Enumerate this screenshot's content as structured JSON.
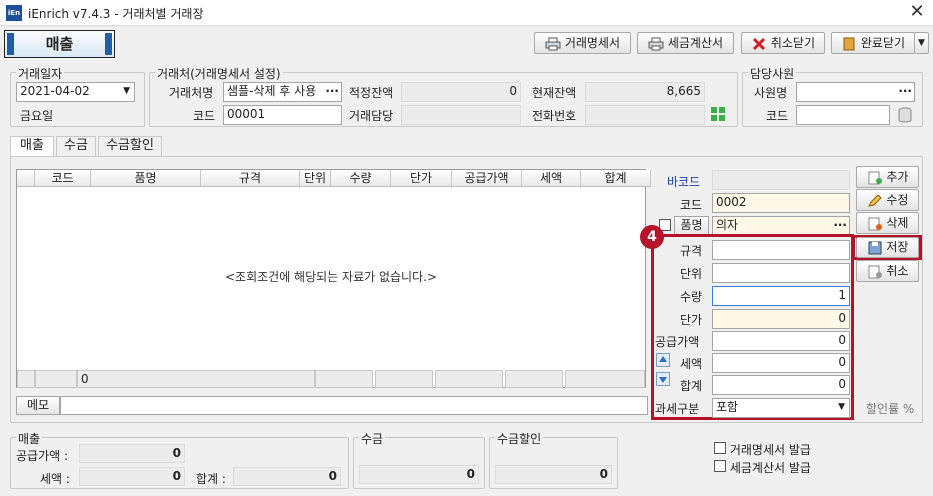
{
  "window": {
    "title": "iEnrich v7.4.3 - 거래처별 거래장",
    "logo_text": "iEn",
    "close": "✕"
  },
  "main_tab": "매출",
  "toolbar": {
    "statement": "거래명세서",
    "tax_invoice": "세금계산서",
    "cancel_close": "취소닫기",
    "done_close": "완료닫기"
  },
  "date_group": {
    "label": "거래일자",
    "date": "2021-04-02",
    "weekday": "금요일"
  },
  "client_group": {
    "label": "거래처(거래명세서 설정)",
    "name_label": "거래처명",
    "name_value": "샘플-삭제 후 사용",
    "code_label": "코드",
    "code_value": "00001",
    "proper_balance_label": "적정잔액",
    "proper_balance_value": "0",
    "current_balance_label": "현재잔액",
    "current_balance_value": "8,665",
    "manager_label": "거래담당",
    "manager_value": "",
    "phone_label": "전화번호",
    "phone_value": ""
  },
  "staff_group": {
    "label": "담당사원",
    "name_label": "사원명",
    "name_value": "",
    "code_label": "코드",
    "code_value": ""
  },
  "subtabs": [
    "매출",
    "수금",
    "수금할인"
  ],
  "grid": {
    "columns": [
      "코드",
      "품명",
      "규격",
      "단위",
      "수량",
      "단가",
      "공급가액",
      "세액",
      "합계"
    ],
    "empty_message": "<조회조건에 해당되는 자료가 없습니다.>",
    "footer_count": "0"
  },
  "memo_label": "메모",
  "form": {
    "barcode_label": "바코드",
    "code_label": "코드",
    "code_value": "0002",
    "item_label": "품명",
    "item_value": "의자",
    "spec_label": "규격",
    "spec_value": "",
    "unit_label": "단위",
    "unit_value": "",
    "qty_label": "수량",
    "qty_value": "1",
    "price_label": "단가",
    "price_value": "0",
    "supply_label": "공급가액",
    "supply_value": "0",
    "tax_label": "세액",
    "tax_value": "0",
    "total_label": "합계",
    "total_value": "0",
    "taxtype_label": "과세구분",
    "taxtype_value": "포함",
    "discount_label": "할인률 %"
  },
  "side_buttons": {
    "add": "추가",
    "edit": "수정",
    "delete": "삭제",
    "save": "저장",
    "cancel": "취소"
  },
  "annotation": "4",
  "summary": {
    "sales_label": "매출",
    "supply_label": "공급가액 :",
    "supply_value": "0",
    "tax_label": "세액 :",
    "tax_value": "0",
    "total_label": "합계 :",
    "total_value": "0",
    "collection_label": "수금",
    "collection_value": "0",
    "discount_label": "수금할인",
    "discount_value": "0"
  },
  "issue": {
    "statement": "거래명세서 발급",
    "tax_invoice": "세금계산서 발급"
  },
  "colors": {
    "accent_red": "#b8122a",
    "tab_blue": "#1f5fa8",
    "link_blue": "#1f3fb0"
  }
}
